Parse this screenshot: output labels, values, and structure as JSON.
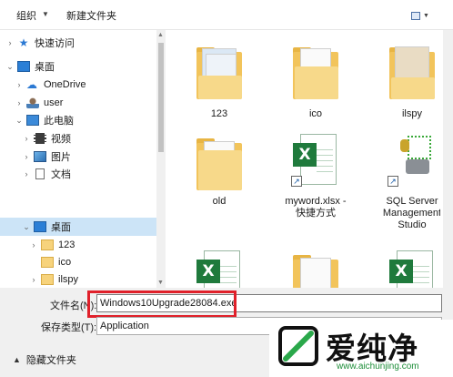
{
  "toolbar": {
    "organize_label": "组织",
    "new_folder_label": "新建文件夹"
  },
  "nav": {
    "items": [
      {
        "label": "快速访问",
        "icon": "quick-access-star-icon"
      },
      {
        "label": "桌面",
        "icon": "desktop-icon"
      },
      {
        "label": "OneDrive",
        "icon": "onedrive-icon"
      },
      {
        "label": "user",
        "icon": "user-icon"
      },
      {
        "label": "此电脑",
        "icon": "this-pc-icon"
      },
      {
        "label": "视频",
        "icon": "videos-icon"
      },
      {
        "label": "图片",
        "icon": "pictures-icon"
      },
      {
        "label": "文档",
        "icon": "documents-icon"
      },
      {
        "label": "桌面",
        "icon": "desktop-icon"
      },
      {
        "label": "123",
        "icon": "folder-icon"
      },
      {
        "label": "ico",
        "icon": "folder-icon"
      },
      {
        "label": "ilspy",
        "icon": "folder-icon"
      }
    ]
  },
  "files": [
    {
      "label": "123",
      "icon": "folder-icon"
    },
    {
      "label": "ico",
      "icon": "folder-icon"
    },
    {
      "label": "ilspy",
      "icon": "folder-icon"
    },
    {
      "label": "old",
      "icon": "folder-icon"
    },
    {
      "label": "myword.xlsx -",
      "label2": "快捷方式",
      "icon": "excel-shortcut-icon"
    },
    {
      "label": "SQL Server",
      "label2": "Management",
      "label3": "Studio",
      "icon": "sql-server-shortcut-icon"
    }
  ],
  "bottom": {
    "filename_label": "文件名(N):",
    "filename_value": "Windows10Upgrade28084.exe",
    "filetype_label": "保存类型(T):",
    "filetype_value": "Application",
    "hide_folders_label": "隐藏文件夹"
  },
  "watermark": {
    "brand": "爱纯净",
    "url": "www.aichunjing.com"
  },
  "colors": {
    "selection": "#cce4f7",
    "highlight_border": "#e0202a",
    "excel_green": "#1f7a3c",
    "folder_yellow": "#f2c45b"
  }
}
